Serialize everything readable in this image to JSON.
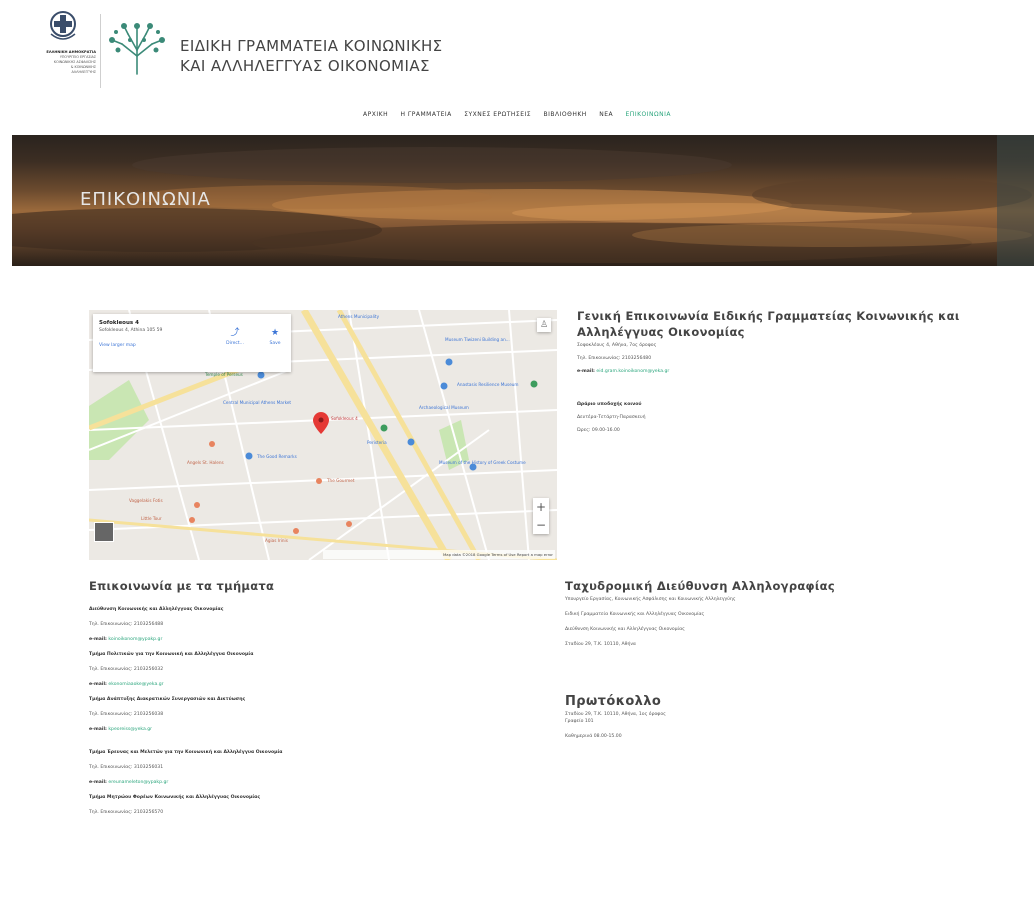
{
  "header": {
    "ministry_lines": [
      "ΕΛΛΗΝΙΚΗ ΔΗΜΟΚΡΑΤΙΑ",
      "ΥΠΟΥΡΓΕΙΟ ΕΡΓΑΣΙΑΣ",
      "ΚΟΙΝΩΝΙΚΗΣ ΑΣΦΑΛΙΣΗΣ",
      "& ΚΟΙΝΩΝΙΚΗΣ",
      "ΑΛΛΗΛΕΓΓΥΗΣ"
    ],
    "brand_line1": "ΕΙΔΙΚΗ ΓΡΑΜΜΑΤΕΙΑ ΚΟΙΝΩΝΙΚΗΣ",
    "brand_line2": "ΚΑΙ ΑΛΛΗΛΕΓΓΥΑΣ ΟΙΚΟΝΟΜΙΑΣ"
  },
  "nav": {
    "items": [
      "ΑΡΧΙΚΗ",
      "Η ΓΡΑΜΜΑΤΕΙΑ",
      "ΣΥΧΝΕΣ ΕΡΩΤΗΣΕΙΣ",
      "ΒΙΒΛΙΟΘΗΚΗ",
      "ΝΕΑ",
      "ΕΠΙΚΟΙΝΩΝΙΑ"
    ],
    "active_index": 5,
    "active_color": "#2aa57c"
  },
  "banner": {
    "title": "ΕΠΙΚΟΙΝΩΝΙΑ"
  },
  "map": {
    "place_title": "Sofokleous 4",
    "place_address": "Sofokleous 4, Athina 105 59",
    "view_larger": "View larger map",
    "directions": "Direct...",
    "save": "Save",
    "marker_label": "Sofokleous 4",
    "labels": [
      "Museum Tiwizeni Building an...",
      "Athens Municipality",
      "Temple of Perseus",
      "Central Municipal Athens Market",
      "Angels St. Halens",
      "Anastasis Resilience Museum",
      "Peristeria",
      "The Good Remarks",
      "Archaeological Museum",
      "Museum of the History of Greek Costume",
      "The Gourmet",
      "Vaggelakis Fotis",
      "Little Tour",
      "Agias Irinis"
    ],
    "zoom_in": "+",
    "zoom_out": "−",
    "attribution": "Map data ©2018 Google   Terms of Use   Report a map error"
  },
  "general": {
    "heading": "Γενική Επικοινωνία Ειδικής Γραμματείας Κοινωνικής και Αλληλέγγυας Οικονομίας",
    "address": "Σοφοκλέους 4, Αθήνα, 7ος όροφος",
    "phone": "Τηλ. Επικοινωνίας: 2103256480",
    "email_label": "e-mail:",
    "email": "eid.gram.koinoikonom@yeka.gr",
    "hours_title": "Ωράριο υποδοχής κοινού",
    "hours_days": "Δευτέρα-Τετάρτη-Παρασκευή",
    "hours_time": "Ώρες: 09.00-16.00"
  },
  "departments": {
    "heading": "Επικοινωνία με τα τμήματα",
    "items": [
      {
        "name": "Διεύθυνση Κοινωνικής και Αλληλέγγυας Οικονομίας",
        "phone": "Τηλ. Επικοινωνίας: 2103256488",
        "email_label": "e-mail:",
        "email": "koinoikonom@ypakp.gr"
      },
      {
        "name": "Τμήμα Πολιτικών για την Κοινωνική και Αλληλέγγυα Οικονομία",
        "phone": "Τηλ. Επικοινωνίας: 2103256032",
        "email_label": "e-mail:",
        "email": "ekonomiaaoke@yeka.gr"
      },
      {
        "name": "Τμήμα Ανάπτυξης Διακρατικών Συνεργασιών και Δικτύωσης",
        "phone": "Τηλ. Επικοινωνίας: 2103256038",
        "email_label": "e-mail:",
        "email": "kpeoreiss@yeka.gr"
      },
      {
        "name": "Τμήμα Έρευνας και Μελετών για την Κοινωνική και Αλληλέγγυα Οικονομία",
        "phone": "Τηλ. Επικοινωνίας: 3103256031",
        "email_label": "e-mail:",
        "email": "ereunameleton@ypakp.gr"
      },
      {
        "name": "Τμήμα Μητρώου Φορέων Κοινωνικής και Αλληλέγγυας Οικονομίας",
        "phone": "Τηλ. Επικοινωνίας: 2103256570",
        "email_label": "",
        "email": ""
      }
    ]
  },
  "postal": {
    "heading": "Ταχυδρομική Διεύθυνση Αλληλογραφίας",
    "lines": [
      "Υπουργείο Εργασίας, Κοινωνικής Ασφάλισης και Κοινωνικής Αλληλεγγύης",
      "Ειδική Γραμματεία Κοινωνικής και Αλληλέγγυας Οικονομίας",
      "Διεύθυνση Κοινωνικής και Αλληλέγγυας Οικονομίας",
      "Σταδίου 29, Τ.Κ. 10110, Αθήνα"
    ]
  },
  "protocol": {
    "heading": "Πρωτόκολλο",
    "lines": [
      "Σταδίου 29, Τ.Κ. 10110, Αθήνα, 1ος όροφος",
      "Γραφείο 101",
      "Καθημερινά 08.00-15.00"
    ]
  }
}
